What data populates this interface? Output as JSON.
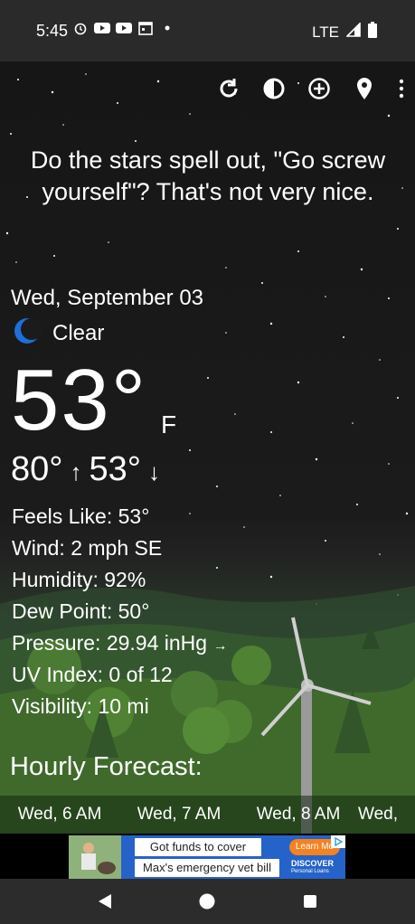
{
  "status_bar": {
    "time": "5:45",
    "network": "LTE",
    "icons": [
      "alarm-icon",
      "youtube-icon",
      "youtube-icon",
      "calendar-icon",
      "dot-icon",
      "signal-icon",
      "battery-icon"
    ]
  },
  "toolbar": {
    "icons": [
      "refresh-icon",
      "theme-icon",
      "add-location-icon",
      "location-pin-icon",
      "more-vert-icon"
    ]
  },
  "tagline": "Do the stars spell out, \"Go screw yourself\"? That's not very nice.",
  "weather": {
    "date": "Wed, September 03",
    "condition": "Clear",
    "condition_icon": "moon-icon",
    "temperature": "53°",
    "unit": "F",
    "high": "80°",
    "high_arrow": "↑",
    "low": "53°",
    "low_arrow": "↓"
  },
  "details": [
    {
      "label": "Feels Like:",
      "value": "53°"
    },
    {
      "label": "Wind:",
      "value": "2 mph SE"
    },
    {
      "label": "Humidity:",
      "value": "92%"
    },
    {
      "label": "Dew Point:",
      "value": "50°"
    },
    {
      "label": "Pressure:",
      "value": "29.94 inHg",
      "trend": "→"
    },
    {
      "label": "UV Index:",
      "value": "0 of 12"
    },
    {
      "label": "Visibility:",
      "value": "10 mi"
    }
  ],
  "hourly": {
    "title": "Hourly Forecast:",
    "items": [
      "Wed, 6 AM",
      "Wed, 7 AM",
      "Wed, 8 AM",
      "Wed,"
    ]
  },
  "ad": {
    "line1": "Got funds to cover",
    "line2": "Max's emergency vet bill",
    "cta": "Learn Mo",
    "brand": "DISCOVER",
    "brand_sub": "Personal Loans"
  },
  "nav": {
    "icons": [
      "back-icon",
      "home-icon",
      "recents-icon"
    ]
  },
  "colors": {
    "background": "#1b1b1b",
    "grass": "#3d6a2d",
    "ad_blue": "#2563c9",
    "ad_orange": "#f58220"
  }
}
